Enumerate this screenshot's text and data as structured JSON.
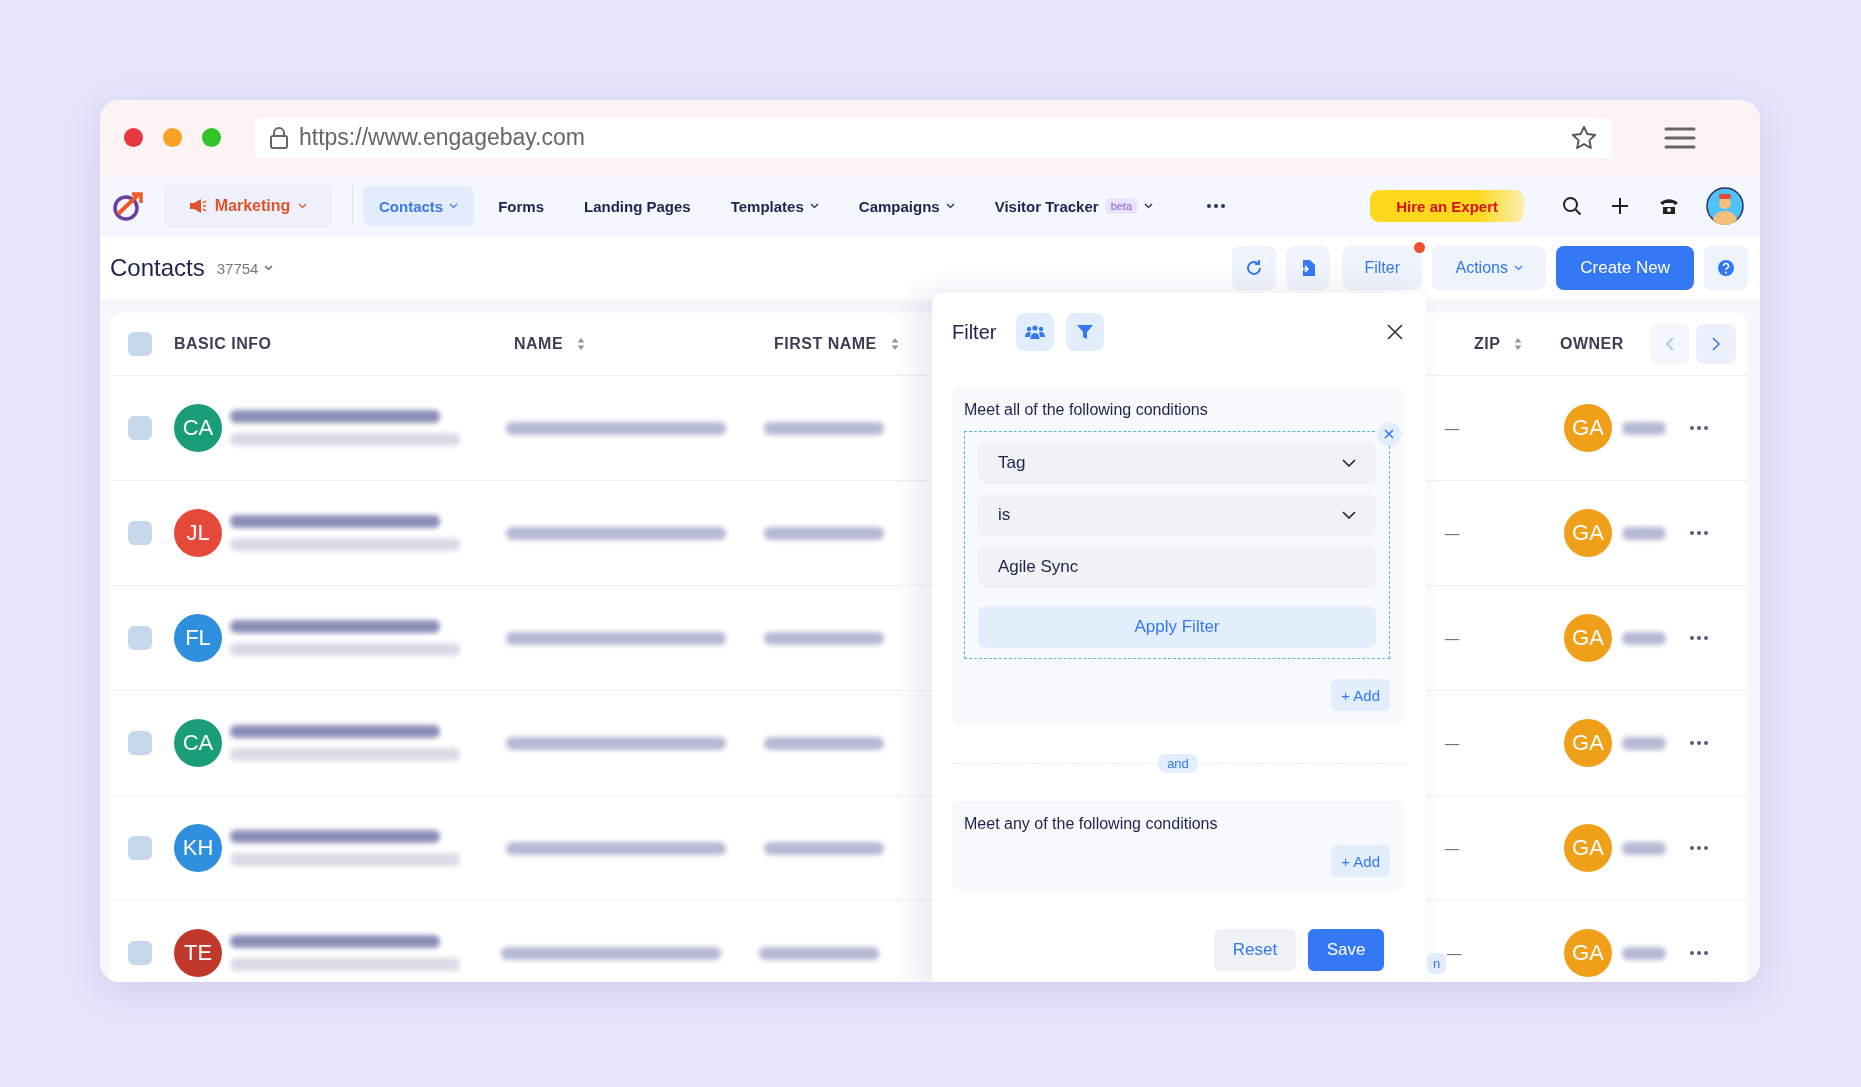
{
  "browser": {
    "url": "https://www.engagebay.com"
  },
  "nav": {
    "module": {
      "label": "Marketing"
    },
    "items": [
      {
        "label": "Contacts",
        "selected": true,
        "dropdown": true
      },
      {
        "label": "Forms",
        "selected": false,
        "dropdown": false
      },
      {
        "label": "Landing Pages",
        "selected": false,
        "dropdown": false
      },
      {
        "label": "Templates",
        "selected": false,
        "dropdown": true
      },
      {
        "label": "Campaigns",
        "selected": false,
        "dropdown": true
      },
      {
        "label": "Visitor Tracker",
        "selected": false,
        "dropdown": true,
        "badge": "beta"
      }
    ],
    "hire_button": "Hire an Expert"
  },
  "header": {
    "title": "Contacts",
    "count": "37754",
    "filter_button": {
      "label": "Filter",
      "alert": true
    },
    "actions_button": "Actions",
    "create_button": "Create New"
  },
  "table": {
    "all_checked": false,
    "columns": [
      {
        "label": "BASIC INFO",
        "sortable": false
      },
      {
        "label": "NAME",
        "sortable": true
      },
      {
        "label": "FIRST NAME",
        "sortable": true
      },
      {
        "label": "ZIP",
        "sortable": true
      },
      {
        "label": "OWNER",
        "sortable": false
      }
    ],
    "rows": [
      {
        "initials": "CA",
        "color": "#1a9e7a",
        "zip": "—",
        "owner": "GA",
        "checked": false
      },
      {
        "initials": "JL",
        "color": "#e5493a",
        "zip": "—",
        "owner": "GA",
        "checked": false
      },
      {
        "initials": "FL",
        "color": "#2d8fdd",
        "zip": "—",
        "owner": "GA",
        "checked": false
      },
      {
        "initials": "CA",
        "color": "#1a9e7a",
        "zip": "—",
        "owner": "GA",
        "checked": false
      },
      {
        "initials": "KH",
        "color": "#2d8fdd",
        "zip": "—",
        "owner": "GA",
        "checked": false
      },
      {
        "initials": "TE",
        "color": "#c0392b",
        "zip": "—",
        "owner": "GA",
        "tag": "n",
        "checked": false
      }
    ]
  },
  "filter_panel": {
    "title": "Filter",
    "groups": [
      {
        "heading": "Meet all of the following conditions",
        "conditions": [
          {
            "field": "Tag",
            "operator": "is",
            "value": "Agile Sync",
            "apply": "Apply Filter"
          }
        ],
        "add": "+ Add"
      },
      {
        "heading": "Meet any of the following conditions",
        "add": "+ Add"
      }
    ],
    "joiner": "and",
    "reset": "Reset",
    "save": "Save"
  }
}
